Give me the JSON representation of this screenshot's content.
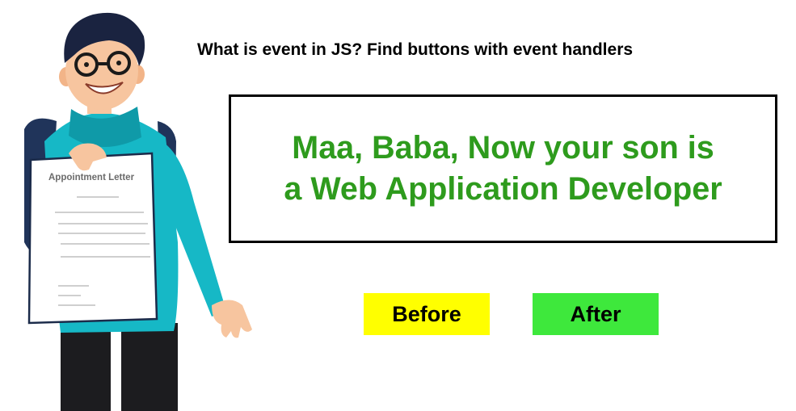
{
  "header": {
    "question": "What is event in JS? Find buttons with event handlers"
  },
  "message": {
    "line1": "Maa, Baba, Now your son is",
    "line2": "a Web Application Developer",
    "color": "#2e9b1d"
  },
  "buttons": {
    "before": {
      "label": "Before",
      "color": "#ffff00"
    },
    "after": {
      "label": "After",
      "color": "#3ee83c"
    }
  },
  "illustration": {
    "letter_title": "Appointment Letter"
  }
}
